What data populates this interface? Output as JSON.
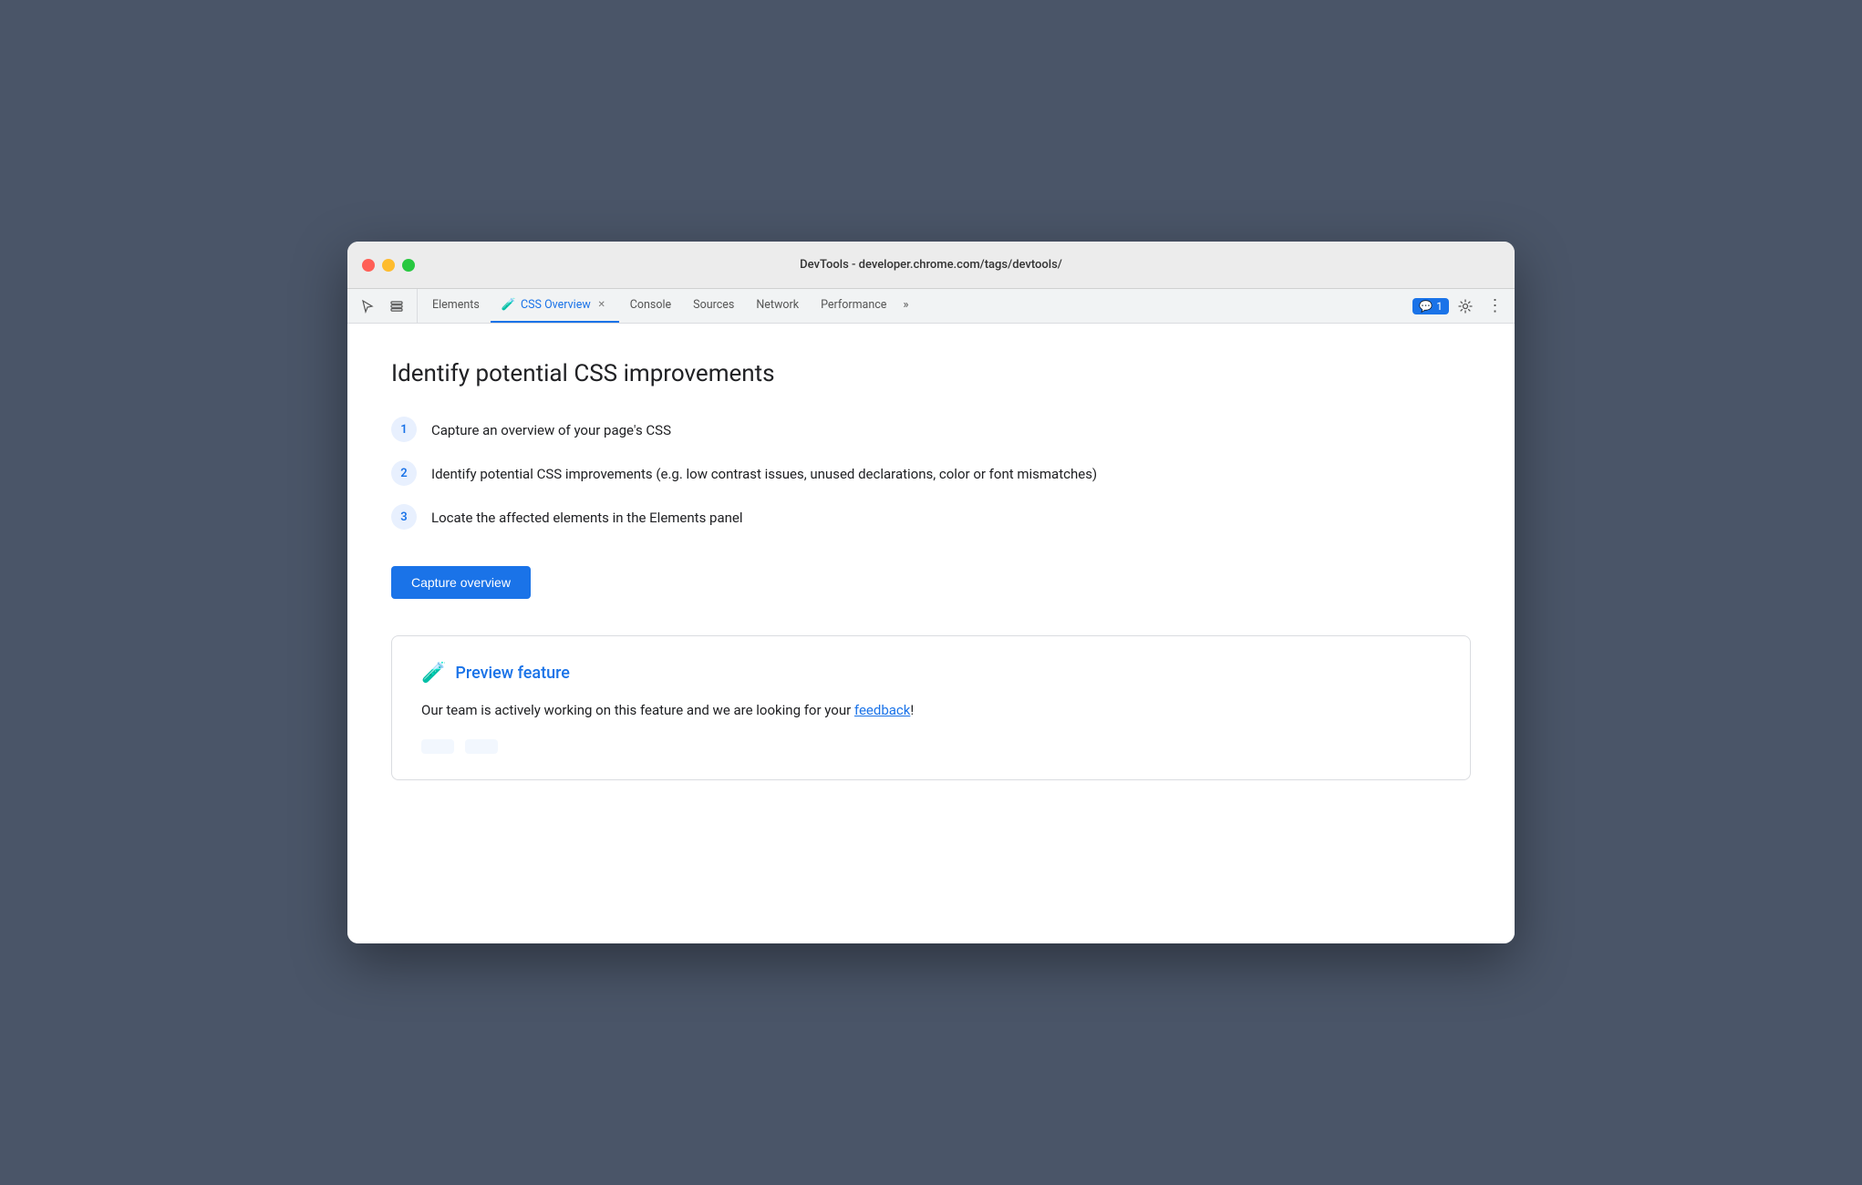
{
  "window": {
    "titlebar": {
      "url": "DevTools - developer.chrome.com/tags/devtools/"
    }
  },
  "toolbar": {
    "tabs": [
      {
        "id": "elements",
        "label": "Elements",
        "active": false,
        "has_close": false,
        "has_flask": false
      },
      {
        "id": "css-overview",
        "label": "CSS Overview",
        "active": true,
        "has_close": true,
        "has_flask": true
      },
      {
        "id": "console",
        "label": "Console",
        "active": false,
        "has_close": false,
        "has_flask": false
      },
      {
        "id": "sources",
        "label": "Sources",
        "active": false,
        "has_close": false,
        "has_flask": false
      },
      {
        "id": "network",
        "label": "Network",
        "active": false,
        "has_close": false,
        "has_flask": false
      },
      {
        "id": "performance",
        "label": "Performance",
        "active": false,
        "has_close": false,
        "has_flask": false
      }
    ],
    "more_tabs_label": "»",
    "notification": {
      "icon": "💬",
      "count": "1"
    }
  },
  "main": {
    "page_title": "Identify potential CSS improvements",
    "steps": [
      {
        "number": "1",
        "text": "Capture an overview of your page's CSS"
      },
      {
        "number": "2",
        "text": "Identify potential CSS improvements (e.g. low contrast issues, unused declarations, color or font mismatches)"
      },
      {
        "number": "3",
        "text": "Locate the affected elements in the Elements panel"
      }
    ],
    "capture_button_label": "Capture overview",
    "preview_card": {
      "title": "Preview feature",
      "body_text": "Our team is actively working on this feature and we are looking for your ",
      "feedback_link": "feedback",
      "body_suffix": "!"
    }
  },
  "icons": {
    "cursor_icon": "⬚",
    "layers_icon": "❐",
    "settings_icon": "⚙",
    "more_icon": "⋮",
    "flask_char": "🧪"
  }
}
